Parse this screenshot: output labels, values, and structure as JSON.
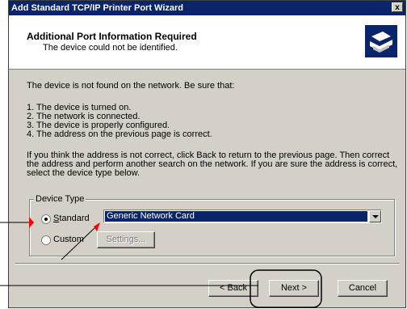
{
  "window": {
    "title": "Add Standard TCP/IP Printer Port Wizard",
    "close_glyph": "x"
  },
  "header": {
    "title": "Additional Port Information Required",
    "subtitle": "The device could not be identified.",
    "icon": "printer-icon"
  },
  "body": {
    "intro": "The device is not found on the network.  Be sure that:",
    "checklist": [
      "1.  The device is turned on.",
      "2.  The network is connected.",
      "3.  The device is properly configured.",
      "4.  The address on the previous page is correct."
    ],
    "instructions": [
      "If you think the address is not correct, click Back to return to the previous page.  Then correct",
      "the address and perform another search on the network.  If you are sure the address is correct,",
      "select the device type below."
    ]
  },
  "device_type": {
    "label": "Device Type",
    "standard_label": "Standard",
    "standard_selected": true,
    "standard_value": "Generic Network Card",
    "custom_label": "Custom",
    "settings_label": "Settings..."
  },
  "buttons": {
    "back": "< Back",
    "next": "Next >",
    "cancel": "Cancel"
  },
  "colors": {
    "titlebar": "#0a246a",
    "dialog_bg": "#d4d0c8",
    "annotation_arrow": "#ff0000"
  }
}
